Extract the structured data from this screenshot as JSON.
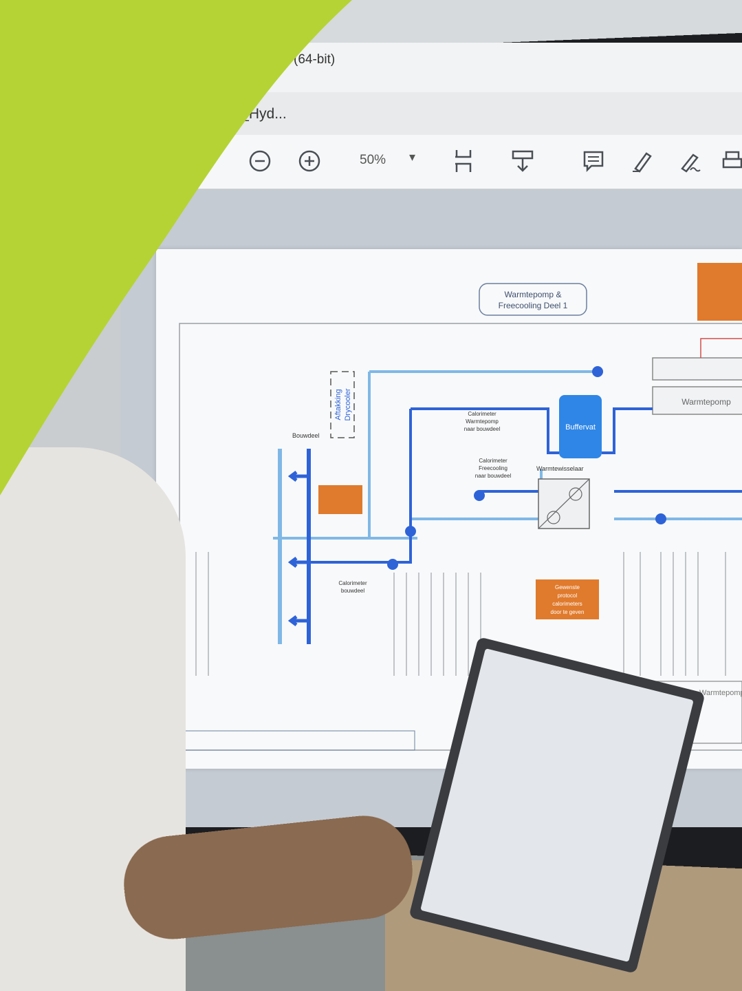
{
  "colors": {
    "brand_green": "#b5d334",
    "accent_orange": "#e07a2c",
    "pipe_blue": "#2e63d8",
    "pipe_light_blue": "#7fb8e6"
  },
  "window": {
    "title": "(64-bit)",
    "tab": "C_Hyd..."
  },
  "toolbar": {
    "zoom": "50%",
    "icons": [
      "hand-icon",
      "zoom-out-icon",
      "zoom-in-icon",
      "fit-page-icon",
      "download-icon",
      "comment-icon",
      "highlight-icon",
      "sign-icon",
      "print-icon"
    ]
  },
  "diagram": {
    "title_line1": "Warmtepomp &",
    "title_line2": "Freecooling Deel 1",
    "buffer": "Buffervat",
    "heatpump": "Warmtepomp",
    "heatpump_bottom": "Warmtepomp",
    "drycooler_line1": "Aftakking",
    "drycooler_line2": "Drycooler",
    "group_label": "Bouwdeel",
    "heat_exchanger": "Warmtewisselaar",
    "calo1_line1": "Calorimeter",
    "calo1_line2": "Warmtepomp",
    "calo1_line3": "naar bouwdeel",
    "calo2_line1": "Calorimeter",
    "calo2_line2": "Freecooling",
    "calo2_line3": "naar bouwdeel",
    "calo3_line1": "Calorimeter",
    "calo3_line2": "bouwdeel",
    "orange_note_line1": "Gewenste",
    "orange_note_line2": "protocol",
    "orange_note_line3": "calorimeters",
    "orange_note_line4": "door te geven"
  }
}
